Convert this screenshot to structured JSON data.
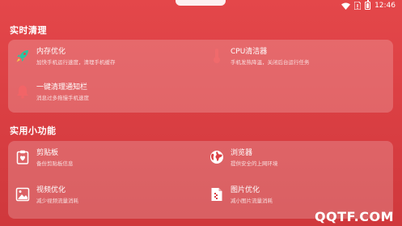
{
  "status": {
    "time": "12:46"
  },
  "sections": [
    {
      "title": "实时清理",
      "items": [
        {
          "title": "内存优化",
          "desc": "加快手机运行速度，清理手机缓存",
          "icon": "rocket-icon"
        },
        {
          "title": "CPU清洁器",
          "desc": "手机发热降温，关闭后台运行任务",
          "icon": "thermometer-icon"
        },
        {
          "title": "一键清理通知栏",
          "desc": "消息过多拖慢手机速度",
          "icon": "bell-icon"
        }
      ]
    },
    {
      "title": "实用小功能",
      "items": [
        {
          "title": "剪贴板",
          "desc": "备份剪贴板信息",
          "icon": "clipboard-icon"
        },
        {
          "title": "浏览器",
          "desc": "提供安全的上网环境",
          "icon": "globe-icon"
        },
        {
          "title": "视频优化",
          "desc": "减少视频流量消耗",
          "icon": "video-icon"
        },
        {
          "title": "图片优化",
          "desc": "减小图片流量消耗",
          "icon": "image-file-icon"
        }
      ]
    }
  ],
  "watermark": "QQTF.COM",
  "colors": {
    "background": "#dc4044",
    "card": "rgba(255,255,255,0.2)"
  }
}
